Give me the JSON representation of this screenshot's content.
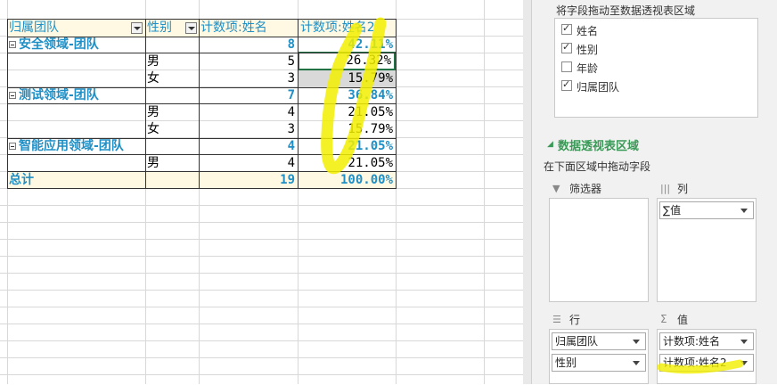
{
  "pivot": {
    "headers": {
      "col1": "归属团队",
      "col2": "性别",
      "col3": "计数项:姓名",
      "col4": "计数项:姓名2"
    },
    "groups": [
      {
        "name": "安全领域-团队",
        "count": "8",
        "pct": "42.11%",
        "rows": [
          {
            "gender": "男",
            "count": "5",
            "pct": "26.32%"
          },
          {
            "gender": "女",
            "count": "3",
            "pct": "15.79%"
          }
        ]
      },
      {
        "name": "测试领域-团队",
        "count": "7",
        "pct": "36.84%",
        "rows": [
          {
            "gender": "男",
            "count": "4",
            "pct": "21.05%"
          },
          {
            "gender": "女",
            "count": "3",
            "pct": "15.79%"
          }
        ]
      },
      {
        "name": "智能应用领域-团队",
        "count": "4",
        "pct": "21.05%",
        "rows": [
          {
            "gender": "男",
            "count": "4",
            "pct": "21.05%"
          }
        ]
      }
    ],
    "total": {
      "label": "总计",
      "count": "19",
      "pct": "100.00%"
    }
  },
  "panel": {
    "drag_hint": "将字段拖动至数据透视表区域",
    "fields": [
      {
        "label": "姓名",
        "checked": true
      },
      {
        "label": "性别",
        "checked": true
      },
      {
        "label": "年龄",
        "checked": false
      },
      {
        "label": "归属团队",
        "checked": true
      }
    ],
    "area_title": "数据透视表区域",
    "area_hint": "在下面区域中拖动字段",
    "filter_label": "筛选器",
    "column_label": "列",
    "column_item": "∑值",
    "row_label": "行",
    "value_label": "值",
    "row_items": [
      "归属团队",
      "性别"
    ],
    "value_items": [
      "计数项:姓名",
      "计数项:姓名2"
    ]
  },
  "colors": {
    "header_text": "#1f8fc5",
    "header_bg": "#fff9e3",
    "highlight": "#f5f200",
    "area_title": "#3a9a57"
  }
}
